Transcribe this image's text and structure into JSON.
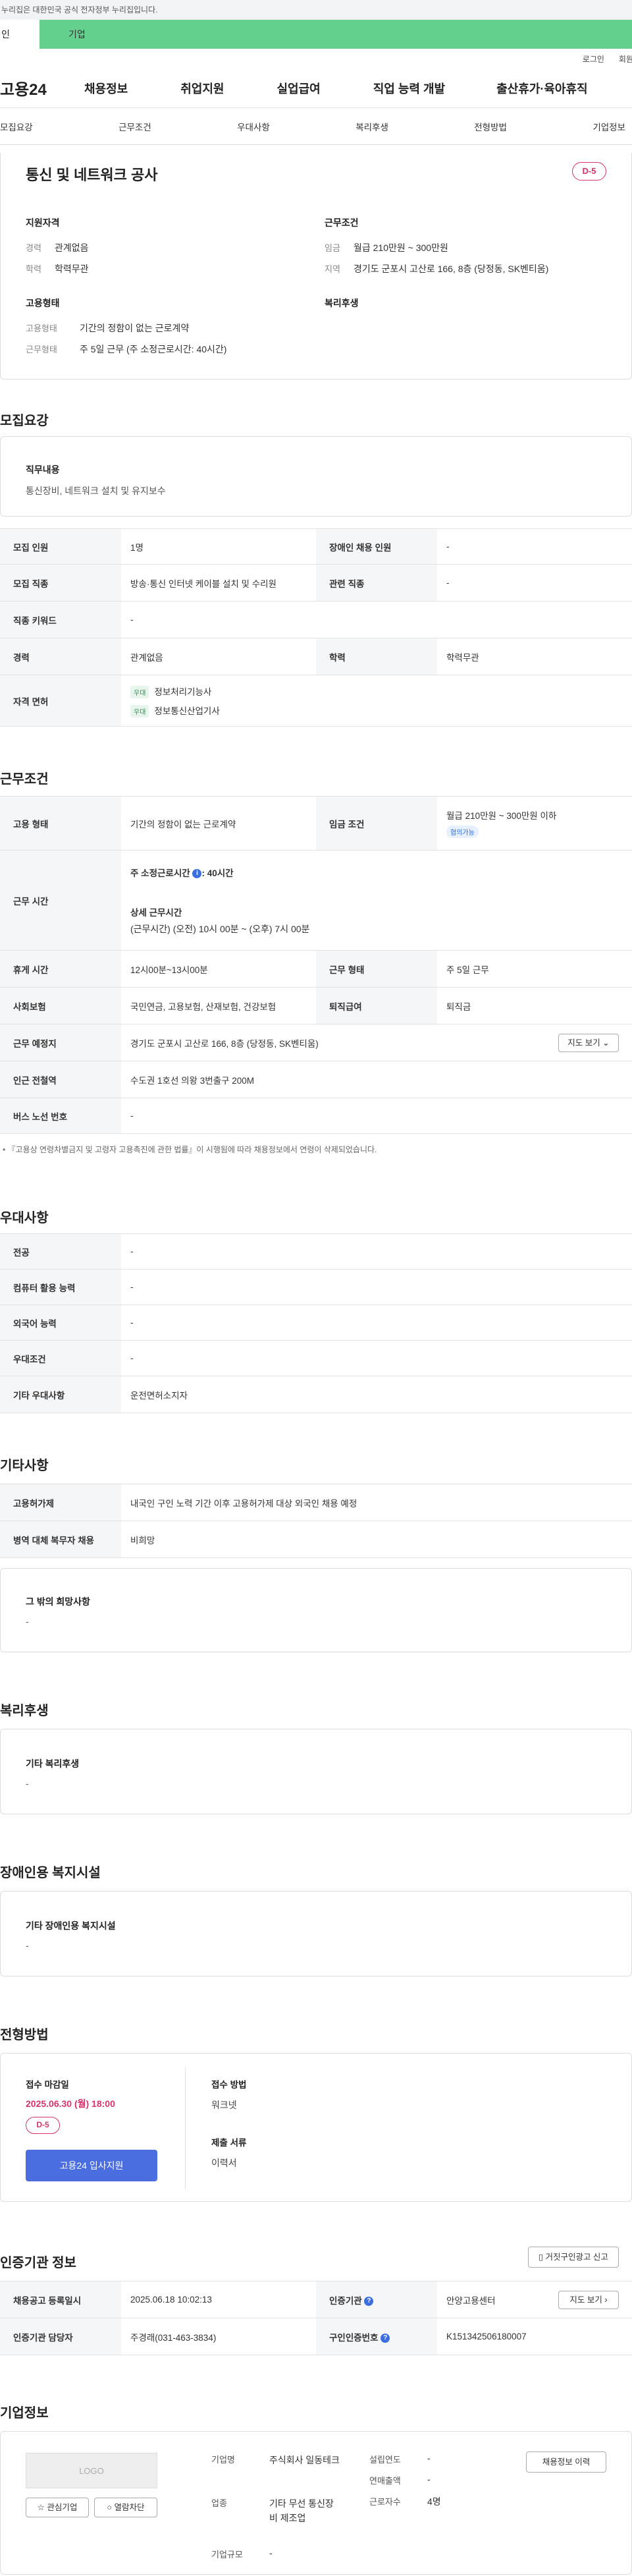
{
  "gov_banner": "이 누리집은 대한민국 공식 전자정부 누리집입니다.",
  "gov_banner_visible": "누리집은 대한민국 공식 전자정부 누리집입니다.",
  "top_tabs": {
    "individual": "인",
    "business": "기업"
  },
  "util": {
    "login": "로그인",
    "join": "회원"
  },
  "gnb": {
    "logo": "고용24",
    "items": [
      "채용정보",
      "취업지원",
      "실업급여",
      "직업 능력 개발",
      "출산휴가·육아휴직"
    ]
  },
  "snb": [
    "모집요강",
    "근무조건",
    "우대사항",
    "복리후생",
    "전형방법",
    "기업정보"
  ],
  "summary": {
    "title": "통신 및 네트워크 공사",
    "dday": "D-5",
    "qualification_title": "지원자격",
    "experience_label": "경력",
    "experience": "관계없음",
    "education_label": "학력",
    "education": "학력무관",
    "condition_title": "근무조건",
    "wage_label": "임금",
    "wage": "월급 210만원 ~ 300만원",
    "location_label": "지역",
    "location": "경기도 군포시 고산로 166, 8층 (당정동, SK벤티움)",
    "employ_title": "고용형태",
    "employ_label": "고용형태",
    "employ": "기간의 정함이 없는 근로계약",
    "work_label": "근무형태",
    "work": "주 5일 근무 (주 소정근로시간: 40시간)",
    "welfare_title": "복리후생"
  },
  "recruit": {
    "section": "모집요강",
    "job_title": "직무내용",
    "job_desc": "통신장비, 네트워크 설치 및 유지보수",
    "rows": {
      "count_label": "모집 인원",
      "count": "1명",
      "disabled_label": "장애인 채용 인원",
      "disabled": "-",
      "occ_label": "모집 직종",
      "occ": "방송·통신 인터넷 케이블 설치 및 수리원",
      "related_label": "관련 직종",
      "related": "-",
      "kw_label": "직종 키워드",
      "kw": "-",
      "exp_label": "경력",
      "exp": "관계없음",
      "edu_label": "학력",
      "edu": "학력무관",
      "license_label": "자격 면허",
      "license_tag": "우대",
      "licenses": [
        "정보처리기능사",
        "정보통신산업기사"
      ]
    }
  },
  "conditions": {
    "section": "근무조건",
    "type_label": "고용 형태",
    "type": "기간의 정함이 없는 근로계약",
    "wage_label": "임금 조건",
    "wage": "월급 210만원 ~ 300만원 이하",
    "wage_tag": "협의가능",
    "hours_label": "근무 시간",
    "weekly": "주 소정근로시간",
    "weekly_val": ": 40시간",
    "detail_title": "상세 근무시간",
    "detail": "(근무시간) (오전) 10시 00분 ~ (오후) 7시 00분",
    "break_label": "휴게 시간",
    "break": "12시00분~13시00분",
    "worktype_label": "근무 형태",
    "worktype": "주 5일 근무",
    "insurance_label": "사회보험",
    "insurance": "국민연금, 고용보험, 산재보험, 건강보험",
    "severance_label": "퇴직급여",
    "severance": "퇴직금",
    "place_label": "근무 예정지",
    "place": "경기도 군포시 고산로 166, 8층 (당정동, SK벤티움)",
    "map_btn": "지도 보기",
    "subway_label": "인근 전철역",
    "subway": "수도권 1호선 의왕 3번출구 200M",
    "bus_label": "버스 노선 번호",
    "bus": "-",
    "notice": "『고용상 연령차별금지 및 고령자 고용촉진에 관한 법률』이 시행됨에 따라 채용정보에서 연령이 삭제되었습니다."
  },
  "preference": {
    "section": "우대사항",
    "major_label": "전공",
    "major": "-",
    "computer_label": "컴퓨터 활용 능력",
    "computer": "-",
    "lang_label": "외국어 능력",
    "lang": "-",
    "cond_label": "우대조건",
    "cond": "-",
    "etc_label": "기타 우대사항",
    "etc": "운전면허소지자"
  },
  "etc": {
    "section": "기타사항",
    "hire_label": "고용허가제",
    "hire": "내국인 구인 노력 기간 이후 고용허가제 대상 외국인 채용 예정",
    "mil_label": "병역 대체 복무자 채용",
    "mil": "비희망",
    "other_title": "그 밖의 희망사항",
    "other": "-"
  },
  "welfare": {
    "section": "복리후생",
    "title": "기타 복리후생",
    "value": "-"
  },
  "disabled_fac": {
    "section": "장애인용 복지시설",
    "title": "기타 장애인용 복지시설",
    "value": "-"
  },
  "process": {
    "section": "전형방법",
    "deadline_label": "접수 마감일",
    "deadline": "2025.06.30 (월) 18:00",
    "dday": "D-5",
    "apply_btn": "고용24 입사지원",
    "method_label": "접수 방법",
    "method": "워크넷",
    "docs_label": "제출 서류",
    "docs": "이력서"
  },
  "agency": {
    "section": "인증기관 정보",
    "report_btn": "거짓구인광고 신고",
    "reg_label": "채용공고 등록일시",
    "reg": "2025.06.18 10:02:13",
    "org_label": "인증기관",
    "org": "안양고용센터",
    "map_btn": "지도 보기",
    "manager_label": "인증기관 담당자",
    "manager": "주경래(031-463-3834)",
    "id_label": "구인인증번호",
    "id": "K151342506180007"
  },
  "company": {
    "section": "기업정보",
    "logo": "LOGO",
    "fav_btn": "관심기업",
    "block_btn": "열람차단",
    "name_label": "기업명",
    "name": "주식회사 일동테크",
    "biz_label": "업종",
    "biz": "기타 무선 통신장비 제조업",
    "scale_label": "기업규모",
    "scale": "-",
    "found_label": "설립연도",
    "found": "-",
    "sales_label": "연매출액",
    "sales": "-",
    "emp_label": "근로자수",
    "emp": "4명",
    "history_btn": "채용정보 이력"
  }
}
